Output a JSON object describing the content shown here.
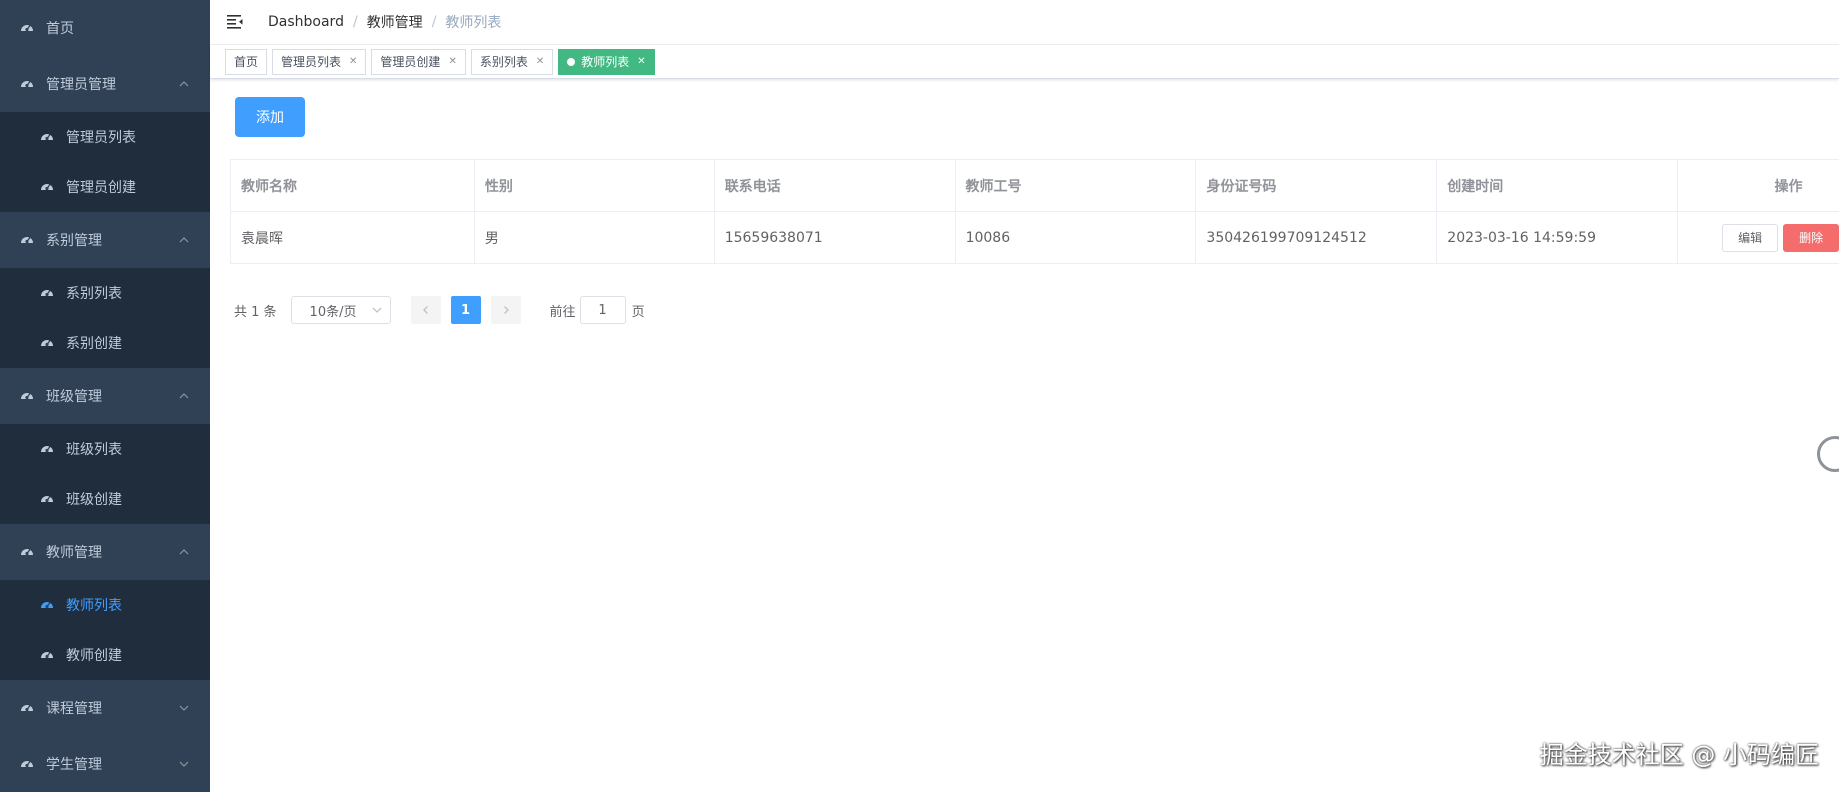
{
  "sidebar": {
    "items": [
      {
        "label": "首页",
        "type": "top"
      },
      {
        "label": "管理员管理",
        "type": "group",
        "expanded": true
      },
      {
        "label": "管理员列表",
        "type": "sub"
      },
      {
        "label": "管理员创建",
        "type": "sub"
      },
      {
        "label": "系别管理",
        "type": "group",
        "expanded": true
      },
      {
        "label": "系别列表",
        "type": "sub"
      },
      {
        "label": "系别创建",
        "type": "sub"
      },
      {
        "label": "班级管理",
        "type": "group",
        "expanded": true
      },
      {
        "label": "班级列表",
        "type": "sub"
      },
      {
        "label": "班级创建",
        "type": "sub"
      },
      {
        "label": "教师管理",
        "type": "group",
        "expanded": true
      },
      {
        "label": "教师列表",
        "type": "sub",
        "active": true
      },
      {
        "label": "教师创建",
        "type": "sub"
      },
      {
        "label": "课程管理",
        "type": "group",
        "expanded": false
      },
      {
        "label": "学生管理",
        "type": "group",
        "expanded": false
      }
    ]
  },
  "breadcrumb": {
    "items": [
      "Dashboard",
      "教师管理",
      "教师列表"
    ],
    "separator": "/"
  },
  "tags": [
    {
      "label": "首页",
      "closable": false,
      "active": false
    },
    {
      "label": "管理员列表",
      "closable": true,
      "active": false
    },
    {
      "label": "管理员创建",
      "closable": true,
      "active": false
    },
    {
      "label": "系别列表",
      "closable": true,
      "active": false
    },
    {
      "label": "教师列表",
      "closable": true,
      "active": true
    }
  ],
  "actions": {
    "add_label": "添加"
  },
  "table": {
    "columns": [
      "教师名称",
      "性别",
      "联系电话",
      "教师工号",
      "身份证号码",
      "创建时间",
      "操作"
    ],
    "rows": [
      [
        "袁晨晖",
        "男",
        "15659638071",
        "10086",
        "350426199709124512",
        "2023-03-16 14:59:59"
      ]
    ],
    "edit_label": "编辑",
    "delete_label": "删除"
  },
  "pagination": {
    "total_text": "共 1 条",
    "page_size": "10条/页",
    "current_page": "1",
    "goto_prefix": "前往",
    "goto_value": "1",
    "goto_suffix": "页"
  },
  "watermark": "掘金技术社区 @ 小码编匠",
  "colors": {
    "sidebar_bg": "#304156",
    "submenu_bg": "#1f2d3d",
    "primary": "#409eff",
    "tag_active": "#42b983",
    "danger": "#f56c6c"
  }
}
